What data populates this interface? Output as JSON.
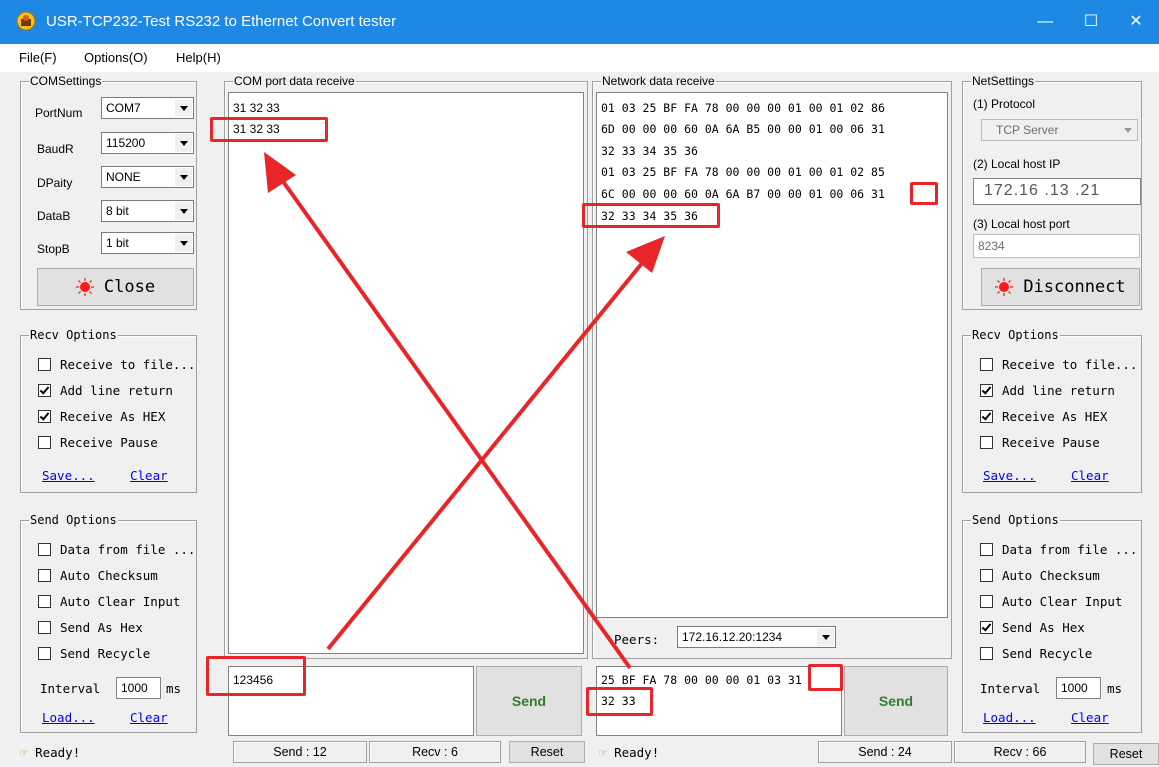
{
  "window": {
    "title": "USR-TCP232-Test  RS232 to Ethernet Convert tester",
    "controls": {
      "minimize": "—",
      "maximize": "☐",
      "close": "✕"
    }
  },
  "menu": [
    "File(F)",
    "Options(O)",
    "Help(H)"
  ],
  "com_settings": {
    "title": "COMSettings",
    "fields": [
      {
        "label": "PortNum",
        "value": "COM7"
      },
      {
        "label": "BaudR",
        "value": "115200"
      },
      {
        "label": "DPaity",
        "value": "NONE"
      },
      {
        "label": "DataB",
        "value": "8 bit"
      },
      {
        "label": "StopB",
        "value": "1 bit"
      }
    ],
    "button": "Close"
  },
  "left_recv_options": {
    "title": "Recv Options",
    "checkboxes": [
      {
        "label": "Receive to file...",
        "checked": false
      },
      {
        "label": "Add line return",
        "checked": true
      },
      {
        "label": "Receive As HEX",
        "checked": true
      },
      {
        "label": "Receive Pause",
        "checked": false
      }
    ],
    "save": "Save...",
    "clear": "Clear"
  },
  "left_send_options": {
    "title": "Send Options",
    "checkboxes": [
      {
        "label": "Data from file ...",
        "checked": false
      },
      {
        "label": "Auto Checksum",
        "checked": false
      },
      {
        "label": "Auto Clear Input",
        "checked": false
      },
      {
        "label": "Send As Hex",
        "checked": false
      },
      {
        "label": "Send Recycle",
        "checked": false
      }
    ],
    "interval_label": "Interval",
    "interval_value": "1000",
    "interval_unit": "ms",
    "load": "Load...",
    "clear": "Clear"
  },
  "com_receive": {
    "title": "COM port data receive",
    "lines": [
      "31 32 33",
      "31 32 33"
    ]
  },
  "com_send": {
    "input": "123456",
    "button": "Send"
  },
  "network_receive": {
    "title": "Network data receive",
    "lines": [
      "01 03 25 BF FA 78 00 00 00 01 00 01 02 86",
      "6D 00 00 00 60 0A 6A B5 00 00 01 00 06 31",
      "32 33 34 35 36",
      "01 03 25 BF FA 78 00 00 00 01 00 01 02 85",
      "6C 00 00 00 60 0A 6A B7 00 00 01 00 06 31",
      "32 33 34 35 36"
    ],
    "peers_label": "Peers:",
    "peers_value": "172.16.12.20:1234"
  },
  "network_send": {
    "lines": [
      "25 BF FA 78 00 00 00 01 03 31",
      "32 33"
    ],
    "button": "Send"
  },
  "net_settings": {
    "title": "NetSettings",
    "protocol_label": "(1) Protocol",
    "protocol_value": "TCP Server",
    "ip_label": "(2) Local host IP",
    "ip_value": "172.16 .13 .21",
    "port_label": "(3) Local host port",
    "port_value": "8234",
    "button": "Disconnect"
  },
  "right_recv_options": {
    "title": "Recv Options",
    "checkboxes": [
      {
        "label": "Receive to file...",
        "checked": false
      },
      {
        "label": "Add line return",
        "checked": true
      },
      {
        "label": "Receive As HEX",
        "checked": true
      },
      {
        "label": "Receive Pause",
        "checked": false
      }
    ],
    "save": "Save...",
    "clear": "Clear"
  },
  "right_send_options": {
    "title": "Send Options",
    "checkboxes": [
      {
        "label": "Data from file ...",
        "checked": false
      },
      {
        "label": "Auto Checksum",
        "checked": false
      },
      {
        "label": "Auto Clear Input",
        "checked": false
      },
      {
        "label": "Send As Hex",
        "checked": true
      },
      {
        "label": "Send Recycle",
        "checked": false
      }
    ],
    "interval_label": "Interval",
    "interval_value": "1000",
    "interval_unit": "ms",
    "load": "Load...",
    "clear": "Clear"
  },
  "status_left": {
    "ready": "Ready!",
    "send": "Send : 12",
    "recv": "Recv : 6",
    "reset": "Reset"
  },
  "status_right": {
    "ready": "Ready!",
    "send": "Send : 24",
    "recv": "Recv : 66",
    "reset": "Reset"
  },
  "colors": {
    "titlebar": "#1e88e5",
    "annotation": "#e8262a",
    "link": "#0000ff"
  }
}
